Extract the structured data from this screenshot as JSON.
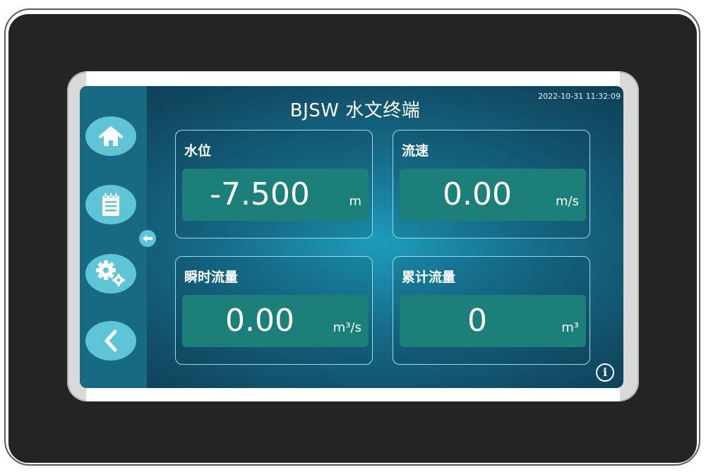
{
  "app": {
    "title": "BJSW 水文终端",
    "datetime": "2022-10-31 11:32:09"
  },
  "sidebar": {
    "items": [
      {
        "icon": "home-icon"
      },
      {
        "icon": "notepad-icon"
      },
      {
        "icon": "gears-icon"
      },
      {
        "icon": "back-icon"
      }
    ],
    "collapse_icon": "arrow-left-icon"
  },
  "cards": [
    {
      "label": "水位",
      "value": "-7.500",
      "unit": "m"
    },
    {
      "label": "流速",
      "value": "0.00",
      "unit": "m/s"
    },
    {
      "label": "瞬时流量",
      "value": "0.00",
      "unit": "m³/s"
    },
    {
      "label": "累计流量",
      "value": "0",
      "unit": "m³"
    }
  ],
  "colors": {
    "sidebar": "#176a82",
    "nav_button": "#5fc4d6",
    "value_box": "#1d7f7a",
    "card_border": "#9fdbe6"
  },
  "info_icon": "info-icon"
}
